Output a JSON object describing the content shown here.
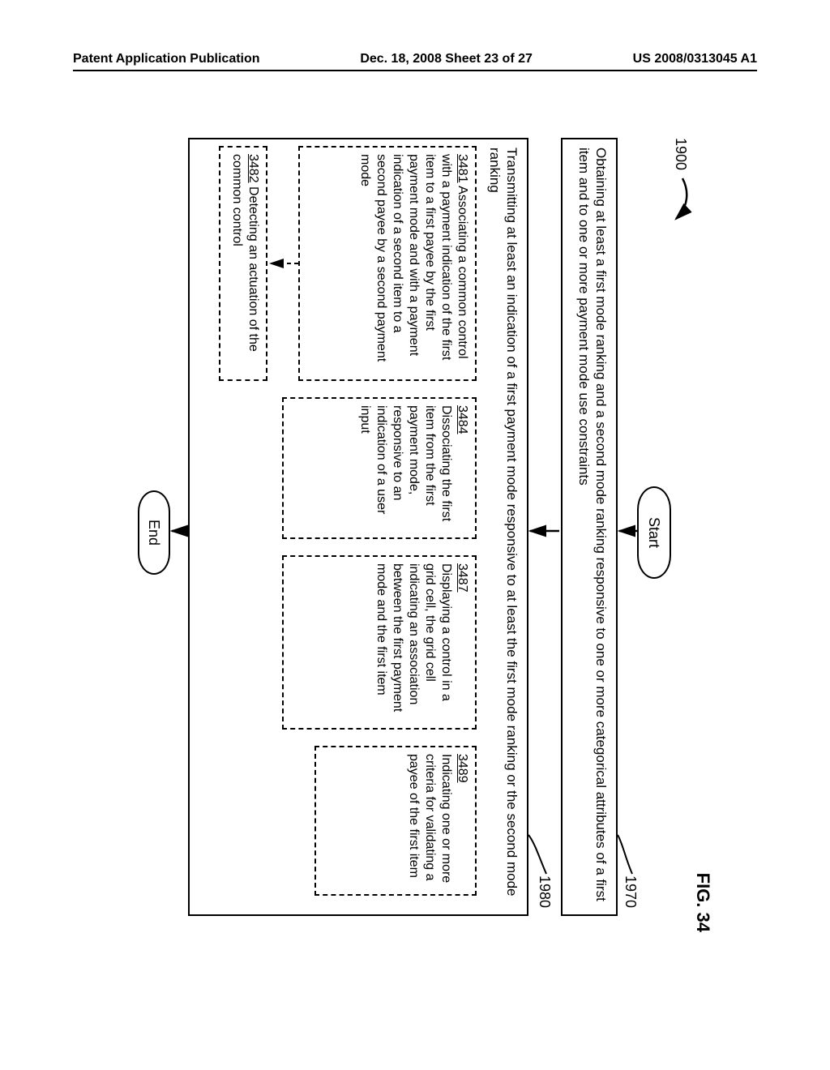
{
  "header": {
    "left": "Patent Application Publication",
    "mid": "Dec. 18, 2008  Sheet 23 of 27",
    "right": "US 2008/0313045 A1"
  },
  "fig": {
    "label": "FIG. 34",
    "flow_ref": "1900",
    "ref1970": "1970",
    "ref1980": "1980",
    "start": "Start",
    "end": "End",
    "box1970": "Obtaining at least a first mode ranking and a second mode ranking responsive to one or more categorical attributes of a first item and to one or more payment mode use constraints",
    "box1980_intro": "Transmitting at least an indication of a first payment mode responsive to at least the first mode ranking or the second mode ranking",
    "b3481_num": "3481",
    "b3481_txt": "  Associating a common control with a payment indication of the first item to a first payee by the first payment mode and with a payment indication of a second item to a second payee by a second payment mode",
    "b3482_num": "3482",
    "b3482_txt": "  Detecting an actuation of the common control",
    "b3484_num": "3484",
    "b3484_txt": "Dissociating the first item from the first payment mode, responsive to an indication of a user input",
    "b3487_num": "3487",
    "b3487_txt": "Displaying a control in a grid cell, the grid cell indicating an association between the first payment mode and the first item",
    "b3489_num": "3489",
    "b3489_txt": "Indicating one or more criteria for validating a payee of the first item"
  }
}
